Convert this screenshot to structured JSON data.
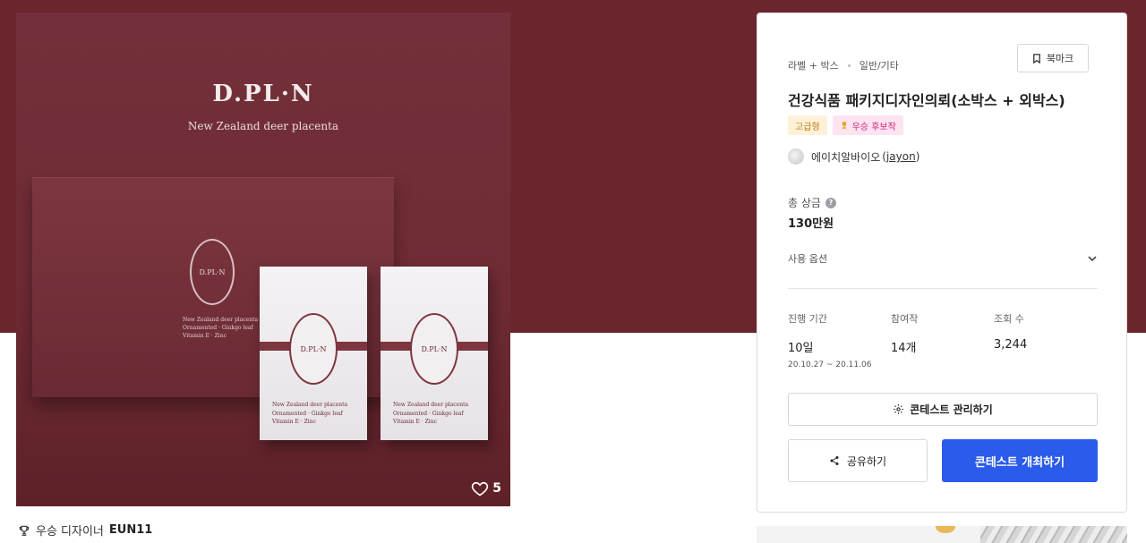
{
  "product_image": {
    "brand": "D.PL·N",
    "subtitle": "New Zealand deer placenta",
    "box_emblem": "D.PL·N",
    "box_text": [
      "New Zealand deer placenta",
      "Ornamented · Ginkgo leaf",
      "Vitamin E · Zinc"
    ],
    "like_count": "5"
  },
  "winner": {
    "label": "우승 디자이너",
    "name": "EUN11"
  },
  "contest": {
    "category": [
      "라벨 + 박스",
      "일반/기타"
    ],
    "bookmark_label": "북마크",
    "title": "건강식품 패키지디자인의뢰(소박스 + 외박스)",
    "badges": [
      "고급형",
      "우승 후보작"
    ],
    "owner_name": "에이치알바이오",
    "owner_id": "jayon",
    "prize_label": "총 상금",
    "prize_help": "?",
    "prize_value": "130만원",
    "options_label": "사용 옵션",
    "stats": [
      {
        "label": "진행 기간",
        "value": "10일",
        "sub": "20.10.27  ~  20.11.06"
      },
      {
        "label": "참여작",
        "value": "14개",
        "sub": ""
      },
      {
        "label": "조회 수",
        "value": "3,244",
        "sub": ""
      }
    ],
    "manage_button": "콘테스트 관리하기",
    "share_button": "공유하기",
    "host_button": "콘테스트 개최하기"
  },
  "colors": {
    "hero_background": "#6a262c",
    "primary_button": "#2a5bea",
    "grade_badge_text": "#c07a10",
    "win_badge_text": "#d21f74"
  },
  "icons": [
    "heart-icon",
    "trophy-icon",
    "bookmark-icon",
    "help-icon",
    "chevron-down-icon",
    "gear-icon",
    "share-icon"
  ]
}
